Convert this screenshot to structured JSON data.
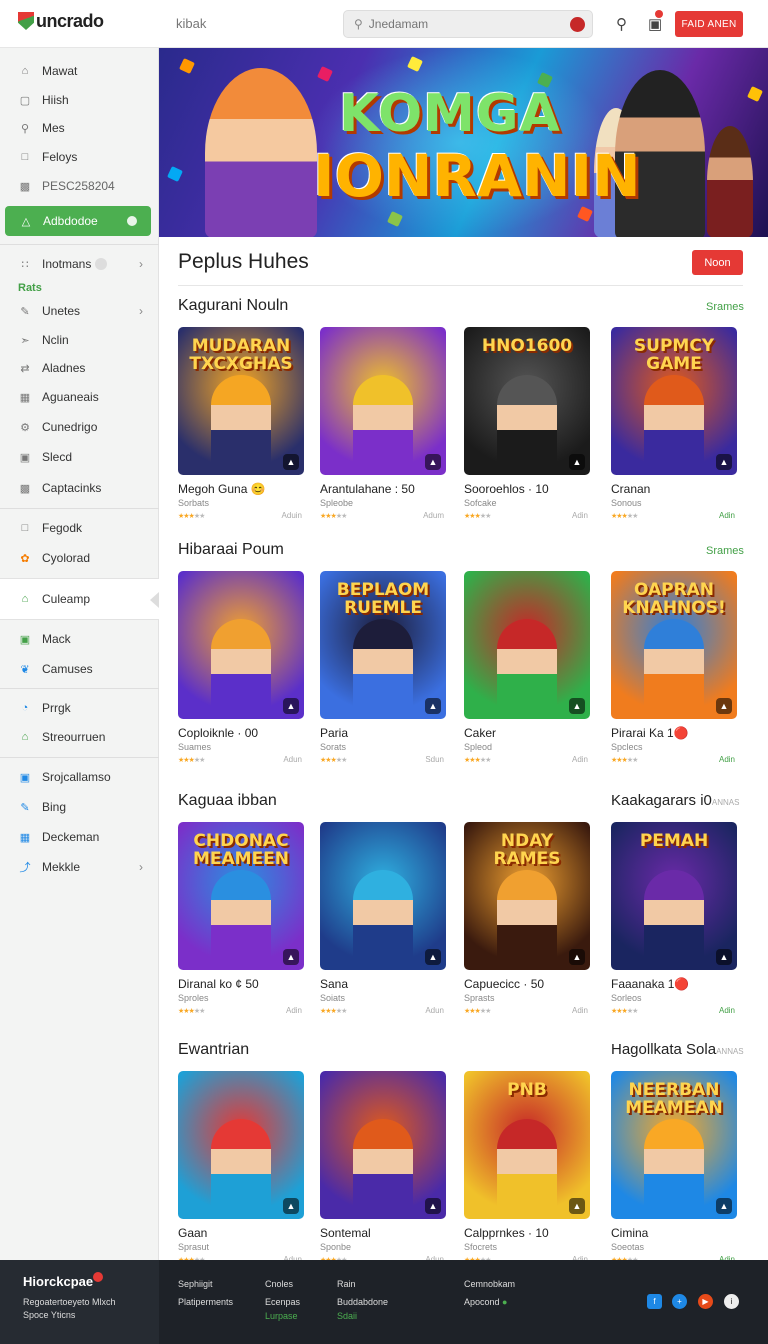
{
  "header": {
    "logo": "uncrado",
    "breadcrumb": "kibak",
    "search_placeholder": "Jnedamam",
    "cta_label": "FAID ANEN",
    "icons": [
      "search-icon",
      "bag-icon",
      "notification-dot"
    ]
  },
  "sidebar": {
    "group1": [
      {
        "label": "Mawat",
        "icon": "home-icon"
      },
      {
        "label": "Hiish",
        "icon": "box-icon"
      },
      {
        "label": "Mes",
        "icon": "search-icon"
      },
      {
        "label": "Feloys",
        "icon": "doc-icon"
      },
      {
        "label": "PESC258204",
        "icon": "image-icon"
      }
    ],
    "active": {
      "label": "Adbdodoe",
      "icon": "lock-icon"
    },
    "group2": [
      {
        "label": "Inotmans",
        "icon": "grid-icon"
      },
      {
        "label": "Rats",
        "icon": "bar-icon"
      },
      {
        "label": "Unetes",
        "icon": "pen-icon"
      },
      {
        "label": "Nclin",
        "icon": "tag-icon"
      },
      {
        "label": "Aladnes",
        "icon": "shuffle-icon"
      },
      {
        "label": "Aguaneais",
        "icon": "doc-icon"
      },
      {
        "label": "Cunedrigo",
        "icon": "gear-icon"
      },
      {
        "label": "Slecd",
        "icon": "lock-icon"
      },
      {
        "label": "Captacinks",
        "icon": "box-icon"
      }
    ],
    "group3": [
      {
        "label": "Fegodk",
        "icon": "doc-icon"
      },
      {
        "label": "Cyolorad",
        "icon": "palette-icon"
      }
    ],
    "highlight": {
      "label": "Culeamp",
      "icon": "home-icon"
    },
    "group4": [
      {
        "label": "Mack",
        "icon": "box-icon"
      },
      {
        "label": "Camuses",
        "icon": "twitter-icon"
      }
    ],
    "group5": [
      {
        "label": "Prrgk",
        "icon": "clock-icon"
      },
      {
        "label": "Streourruen",
        "icon": "home-icon"
      }
    ],
    "group6": [
      {
        "label": "Srojcallamso",
        "icon": "box-icon"
      },
      {
        "label": "Bing",
        "icon": "edit-icon"
      },
      {
        "label": "Deckeman",
        "icon": "calendar-icon"
      },
      {
        "label": "Mekkle",
        "icon": "share-icon"
      }
    ]
  },
  "banner": {
    "line1": "KOMGA",
    "line2": "IONRANIN"
  },
  "main": {
    "title": "Peplus Huhes",
    "button": "Noon"
  },
  "sections": [
    {
      "title": "Kagurani Nouln",
      "link": "Srames",
      "cards": [
        {
          "caption": "MUDARAN TXCXGHAS",
          "title": "Megoh Guna 😊",
          "sub": "Sorbats",
          "stars": 3,
          "action": "Aduin",
          "colors": [
            "#2a2f6b",
            "#f5a623"
          ]
        },
        {
          "caption": "",
          "title": "Arantulahane : 50",
          "sub": "Spleobe",
          "stars": 3,
          "action": "Adum",
          "colors": [
            "#7b2fc9",
            "#f0c12a"
          ]
        },
        {
          "caption": "HNO1600",
          "title": "Sooroehlos · 10",
          "sub": "Sofcake",
          "stars": 3,
          "action": "Adin",
          "colors": [
            "#1b1b1b",
            "#555"
          ]
        },
        {
          "caption": "SUPMCY GAME",
          "title": "Cranan",
          "sub": "Sonous",
          "stars": 3,
          "action": "Adin",
          "colors": [
            "#3a2a9e",
            "#e05a1b"
          ]
        }
      ]
    },
    {
      "title": "Hibaraai Poum",
      "link": "Srames",
      "cards": [
        {
          "caption": "",
          "title": "Coploiknle · 00",
          "sub": "Suames",
          "stars": 3,
          "action": "Adun",
          "colors": [
            "#5b2fc9",
            "#f0a030"
          ]
        },
        {
          "caption": "BEPLAOM RUEMLE",
          "title": "Paria",
          "sub": "Sorats",
          "stars": 3,
          "action": "Sdun",
          "colors": [
            "#3b6fe0",
            "#1d1d3a"
          ]
        },
        {
          "caption": "",
          "title": "Caker",
          "sub": "Spleod",
          "stars": 3,
          "action": "Adin",
          "colors": [
            "#2fb04a",
            "#c62828"
          ]
        },
        {
          "caption": "OAPRAN KNAHNOS!",
          "title": "Pirarai Ka 1🔴",
          "sub": "Spclecs",
          "stars": 3,
          "action": "Adin",
          "colors": [
            "#f07c1e",
            "#2f7fd9"
          ]
        }
      ]
    },
    {
      "title": "Kaguaa ibban",
      "right_title": "Kaakagarars i0",
      "right_small": "ANNAS",
      "cards": [
        {
          "caption": "CHDONAC MEAMEEN",
          "title": "Diranal ko ¢ 50",
          "sub": "Sproles",
          "stars": 3,
          "action": "Adin",
          "colors": [
            "#7b2fc9",
            "#2a8fe0"
          ]
        },
        {
          "caption": "",
          "title": "Sana",
          "sub": "Soiats",
          "stars": 3,
          "action": "Adun",
          "colors": [
            "#1f3c8a",
            "#2fb0e0"
          ]
        },
        {
          "caption": "NDAY RAMES",
          "title": "Capuecicc · 50",
          "sub": "Sprasts",
          "stars": 3,
          "action": "Adin",
          "colors": [
            "#3a1a0e",
            "#f0a030"
          ]
        },
        {
          "caption": "PEMAH",
          "title": "Faaanaka 1🔴",
          "sub": "Sorleos",
          "stars": 3,
          "action": "Adin",
          "colors": [
            "#1a2560",
            "#6a2aa8"
          ]
        }
      ]
    },
    {
      "title": "Ewantrian",
      "right_title": "Hagollkata Sola",
      "right_small": "ANNAS",
      "cards": [
        {
          "caption": "",
          "title": "Gaan",
          "sub": "Sprasut",
          "stars": 3,
          "action": "Adun",
          "colors": [
            "#1ea0d6",
            "#e53935"
          ]
        },
        {
          "caption": "",
          "title": "Sontemal",
          "sub": "Sponbe",
          "stars": 3,
          "action": "Adun",
          "colors": [
            "#4a2aa8",
            "#e05a1b"
          ]
        },
        {
          "caption": "PNB",
          "title": "Calpprnkes · 10",
          "sub": "Sfocrets",
          "stars": 3,
          "action": "Adin",
          "colors": [
            "#f0c12a",
            "#c62828"
          ]
        },
        {
          "caption": "NEERBAN MEAMEAN",
          "title": "Cimina",
          "sub": "Soeotas",
          "stars": 3,
          "action": "Adin",
          "colors": [
            "#1e88e5",
            "#f9a825"
          ]
        }
      ]
    }
  ],
  "footer": {
    "brand": "Hiorckcpae",
    "left_lines": [
      "Regoatertoeyeto Mlxch",
      "Spoce Yticns"
    ],
    "col1": [
      "Sephiigit",
      "Platiperments"
    ],
    "col2": [
      "Cnoles",
      "Ecenpas",
      "Lurpase"
    ],
    "col3": [
      "Rain",
      "Buddabdone",
      "Sdaii"
    ],
    "col4": [
      "Cemnobkam",
      "Apocond"
    ],
    "social": [
      "facebook-icon",
      "twitter-icon",
      "youtube-icon",
      "info-icon"
    ]
  }
}
